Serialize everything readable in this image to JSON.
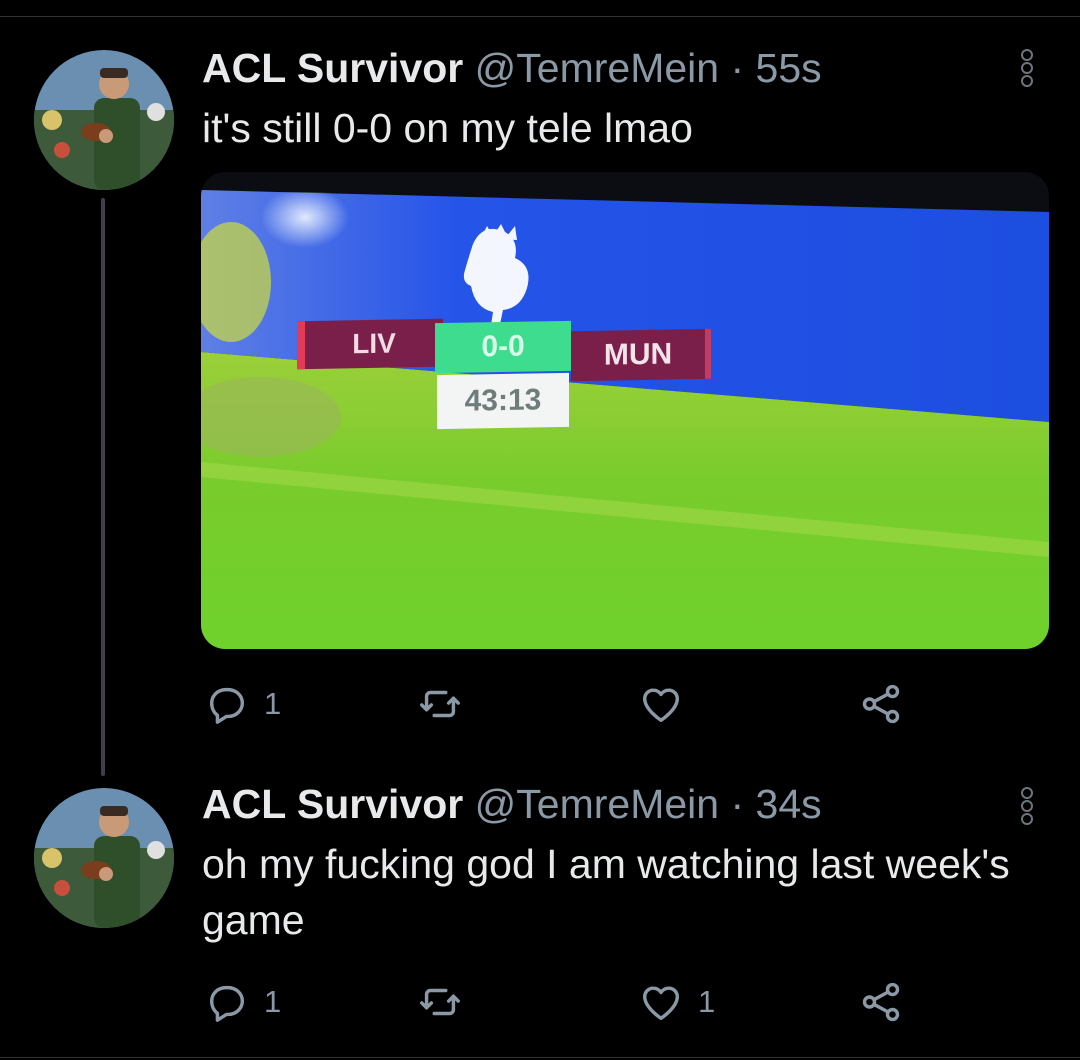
{
  "tweets": [
    {
      "name": "ACL Survivor",
      "handle": "@TemreMein",
      "separator": "·",
      "time": "55s",
      "text": "it's still 0-0 on my tele lmao",
      "media": {
        "home_team": "LIV",
        "score": "0-0",
        "away_team": "MUN",
        "clock": "43:13"
      },
      "counts": {
        "reply": "1",
        "retweet": "",
        "like": ""
      }
    },
    {
      "name": "ACL Survivor",
      "handle": "@TemreMein",
      "separator": "·",
      "time": "34s",
      "text": "oh my fucking god I am watching last week's game",
      "counts": {
        "reply": "1",
        "retweet": "",
        "like": "1"
      }
    }
  ],
  "colors": {
    "background": "#000000",
    "primary_text": "#e7e9ea",
    "secondary_text": "#8b98a5",
    "divider": "#2f3336",
    "pitch_green": "#7fd12f",
    "tv_blue": "#1f52e6",
    "score_green": "#3ddc8e",
    "team_maroon": "#7a1f4a"
  },
  "icons": [
    "more-icon",
    "reply-icon",
    "retweet-icon",
    "like-icon",
    "share-icon"
  ]
}
